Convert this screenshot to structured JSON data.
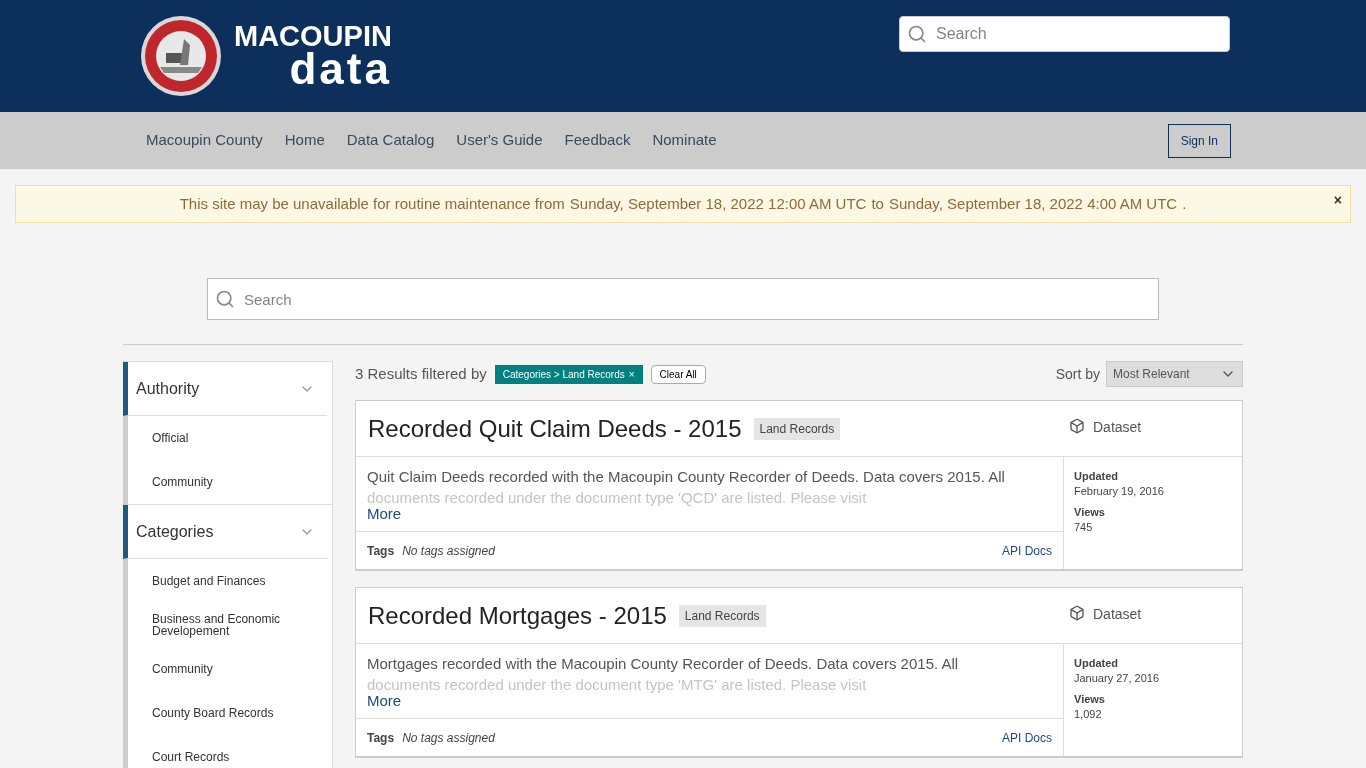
{
  "header": {
    "logo_line_1": "MACOUPIN",
    "logo_line_2": "data",
    "search": {
      "placeholder": "Search"
    }
  },
  "nav": {
    "items": [
      "Macoupin County",
      "Home",
      "Data Catalog",
      "User's Guide",
      "Feedback",
      "Nominate"
    ],
    "sign_in": "Sign In"
  },
  "alert": {
    "parts": [
      "This site may be unavailable for routine maintenance from",
      "Sunday, September 18, 2022 12:00 AM UTC",
      "to",
      "Sunday, September 18, 2022 4:00 AM UTC",
      "."
    ],
    "close": "×"
  },
  "search": {
    "placeholder": "Search"
  },
  "facets": [
    {
      "title": "Authority",
      "expanded": true,
      "items": [
        "Official",
        "Community"
      ]
    },
    {
      "title": "Categories",
      "expanded": true,
      "items": [
        "Budget and Finances",
        "Business and Economic Developement",
        "Community",
        "County Board Records",
        "Court Records"
      ]
    }
  ],
  "results_header": {
    "count": "3 Results filtered by",
    "filter": "Categories > Land Records",
    "filter_remove": "×",
    "clear": "Clear All",
    "sort_label": "Sort by",
    "sort_value": "Most Relevant"
  },
  "results": [
    {
      "title": "Recorded Quit Claim Deeds - 2015",
      "category": "Land Records",
      "type": "Dataset",
      "description_line_1": "Quit Claim Deeds recorded with the Macoupin County Recorder of Deeds. Data covers 2015. All",
      "description_line_2": "documents recorded under the document type 'QCD' are listed. Please visit",
      "more": "More",
      "tags_label": "Tags",
      "tags": "No tags assigned",
      "api": "API Docs",
      "updated_label": "Updated",
      "updated": "February 19, 2016",
      "views_label": "Views",
      "views": "745"
    },
    {
      "title": "Recorded Mortgages - 2015",
      "category": "Land Records",
      "type": "Dataset",
      "description_line_1": "Mortgages recorded with the Macoupin County Recorder of Deeds. Data covers 2015. All",
      "description_line_2": "documents recorded under the document type 'MTG' are listed. Please visit",
      "more": "More",
      "tags_label": "Tags",
      "tags": "No tags assigned",
      "api": "API Docs",
      "updated_label": "Updated",
      "updated": "January 27, 2016",
      "views_label": "Views",
      "views": "1,092"
    }
  ]
}
